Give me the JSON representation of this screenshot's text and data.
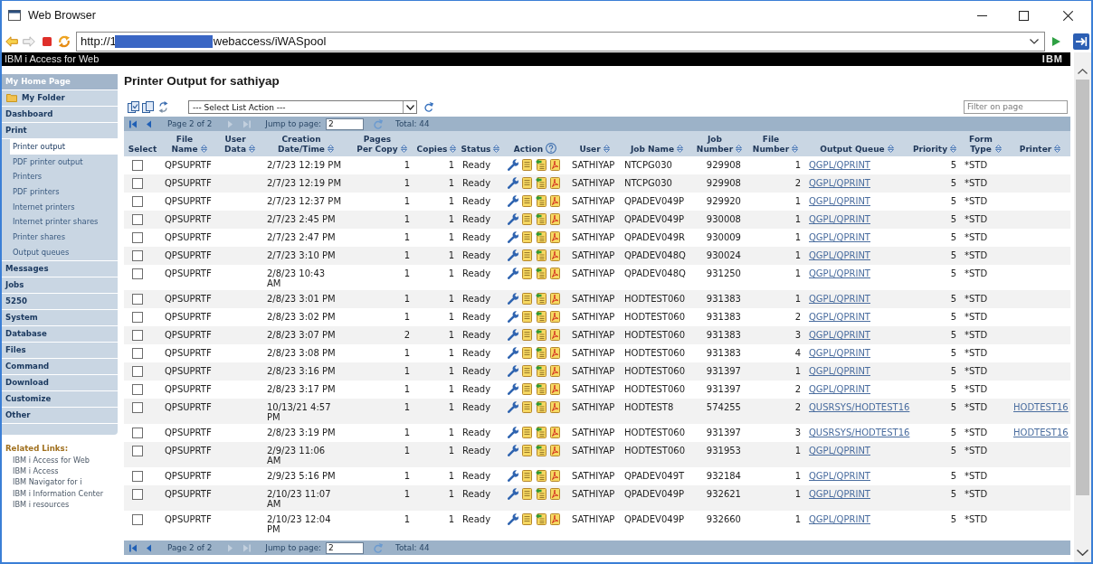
{
  "window": {
    "title": "Web Browser"
  },
  "address_bar": {
    "url_start": "http://1",
    "redacted": true,
    "url_end": "webaccess/iWASpool"
  },
  "banner": {
    "product": "IBM i Access for Web",
    "logo": "IBM"
  },
  "sidebar": {
    "items": [
      {
        "label": "My Home Page",
        "kind": "home",
        "selected": false
      },
      {
        "label": "My Folder",
        "kind": "folder",
        "selected": false
      },
      {
        "label": "Dashboard",
        "kind": "category",
        "selected": false
      },
      {
        "label": "Print",
        "kind": "category",
        "selected": false,
        "children": [
          {
            "label": "Printer output",
            "selected": true
          },
          {
            "label": "PDF printer output",
            "selected": false
          },
          {
            "label": "Printers",
            "selected": false
          },
          {
            "label": "PDF printers",
            "selected": false
          },
          {
            "label": "Internet printers",
            "selected": false
          },
          {
            "label": "Internet printer shares",
            "selected": false
          },
          {
            "label": "Printer shares",
            "selected": false
          },
          {
            "label": "Output queues",
            "selected": false
          }
        ]
      },
      {
        "label": "Messages",
        "kind": "category",
        "selected": false
      },
      {
        "label": "Jobs",
        "kind": "category",
        "selected": false
      },
      {
        "label": "5250",
        "kind": "category",
        "selected": false
      },
      {
        "label": "System",
        "kind": "category",
        "selected": false
      },
      {
        "label": "Database",
        "kind": "category",
        "selected": false
      },
      {
        "label": "Files",
        "kind": "category",
        "selected": false
      },
      {
        "label": "Command",
        "kind": "category",
        "selected": false
      },
      {
        "label": "Download",
        "kind": "category",
        "selected": false
      },
      {
        "label": "Customize",
        "kind": "category",
        "selected": false
      },
      {
        "label": "Other",
        "kind": "category",
        "selected": false
      }
    ]
  },
  "related_links": {
    "heading": "Related Links:",
    "links": [
      "IBM i Access for Web",
      "IBM i Access",
      "IBM Navigator for i",
      "IBM i Information Center",
      "IBM i resources"
    ]
  },
  "page": {
    "title": "Printer Output for sathiyap"
  },
  "toolbar": {
    "list_action": "--- Select List Action ---",
    "filter_placeholder": "Filter on page"
  },
  "pagers": [
    {
      "first_disabled": false,
      "previous_disabled": false,
      "page_label": "Page 2 of 2",
      "next_disabled": true,
      "last_disabled": true,
      "jump_label": "Jump to page:",
      "jump_value": "2",
      "total": "Total: 44"
    },
    {
      "first_disabled": false,
      "previous_disabled": false,
      "page_label": "Page 2 of 2",
      "next_disabled": true,
      "last_disabled": true,
      "jump_label": "Jump to page:",
      "jump_value": "2",
      "total": "Total: 44"
    }
  ],
  "table": {
    "columns": [
      {
        "label": "Select",
        "kind": "plain"
      },
      {
        "label": "File\nName",
        "kind": "sortable"
      },
      {
        "label": "User\nData",
        "kind": "sortable"
      },
      {
        "label": "Creation\nDate/Time",
        "kind": "sortable"
      },
      {
        "label": "Pages\nPer Copy",
        "kind": "sortable"
      },
      {
        "label": "Copies",
        "kind": "sortable"
      },
      {
        "label": "Status",
        "kind": "sortable"
      },
      {
        "label": "Action",
        "kind": "help"
      },
      {
        "label": "User",
        "kind": "sortable"
      },
      {
        "label": "Job Name",
        "kind": "sortable"
      },
      {
        "label": "Job\nNumber",
        "kind": "sortable"
      },
      {
        "label": "File\nNumber",
        "kind": "sortable"
      },
      {
        "label": "Output Queue",
        "kind": "sortable"
      },
      {
        "label": "Priority",
        "kind": "sortable"
      },
      {
        "label": "Form\nType",
        "kind": "sortable"
      },
      {
        "label": "Printer",
        "kind": "sortable"
      }
    ],
    "rows": [
      {
        "checked": false,
        "file_name": "QPSUPRTF",
        "created": "2/7/23 12:19 PM",
        "pages_per_copy": "1",
        "copies": "1",
        "status": "Ready",
        "user": "SATHIYAP",
        "job_name": "NTCPG030",
        "job_number": "929908",
        "file_number": "1",
        "output_queue": "QGPL/QPRINT",
        "priority": "5",
        "form_type": "*STD"
      },
      {
        "checked": false,
        "file_name": "QPSUPRTF",
        "created": "2/7/23 12:19 PM",
        "pages_per_copy": "1",
        "copies": "1",
        "status": "Ready",
        "user": "SATHIYAP",
        "job_name": "NTCPG030",
        "job_number": "929908",
        "file_number": "2",
        "output_queue": "QGPL/QPRINT",
        "priority": "5",
        "form_type": "*STD"
      },
      {
        "checked": false,
        "file_name": "QPSUPRTF",
        "created": "2/7/23 12:37 PM",
        "pages_per_copy": "1",
        "copies": "1",
        "status": "Ready",
        "user": "SATHIYAP",
        "job_name": "QPADEV049P",
        "job_number": "929920",
        "file_number": "1",
        "output_queue": "QGPL/QPRINT",
        "priority": "5",
        "form_type": "*STD"
      },
      {
        "checked": false,
        "file_name": "QPSUPRTF",
        "created": "2/7/23 2:45 PM",
        "pages_per_copy": "1",
        "copies": "1",
        "status": "Ready",
        "user": "SATHIYAP",
        "job_name": "QPADEV049P",
        "job_number": "930008",
        "file_number": "1",
        "output_queue": "QGPL/QPRINT",
        "priority": "5",
        "form_type": "*STD"
      },
      {
        "checked": false,
        "file_name": "QPSUPRTF",
        "created": "2/7/23 2:47 PM",
        "pages_per_copy": "1",
        "copies": "1",
        "status": "Ready",
        "user": "SATHIYAP",
        "job_name": "QPADEV049R",
        "job_number": "930009",
        "file_number": "1",
        "output_queue": "QGPL/QPRINT",
        "priority": "5",
        "form_type": "*STD"
      },
      {
        "checked": false,
        "file_name": "QPSUPRTF",
        "created": "2/7/23 3:10 PM",
        "pages_per_copy": "1",
        "copies": "1",
        "status": "Ready",
        "user": "SATHIYAP",
        "job_name": "QPADEV048Q",
        "job_number": "930024",
        "file_number": "1",
        "output_queue": "QGPL/QPRINT",
        "priority": "5",
        "form_type": "*STD"
      },
      {
        "checked": false,
        "file_name": "QPSUPRTF",
        "created": "2/8/23 10:43\nAM",
        "pages_per_copy": "1",
        "copies": "1",
        "status": "Ready",
        "user": "SATHIYAP",
        "job_name": "QPADEV048Q",
        "job_number": "931250",
        "file_number": "1",
        "output_queue": "QGPL/QPRINT",
        "priority": "5",
        "form_type": "*STD"
      },
      {
        "checked": false,
        "file_name": "QPSUPRTF",
        "created": "2/8/23 3:01 PM",
        "pages_per_copy": "1",
        "copies": "1",
        "status": "Ready",
        "user": "SATHIYAP",
        "job_name": "HODTEST060",
        "job_number": "931383",
        "file_number": "1",
        "output_queue": "QGPL/QPRINT",
        "priority": "5",
        "form_type": "*STD"
      },
      {
        "checked": false,
        "file_name": "QPSUPRTF",
        "created": "2/8/23 3:02 PM",
        "pages_per_copy": "1",
        "copies": "1",
        "status": "Ready",
        "user": "SATHIYAP",
        "job_name": "HODTEST060",
        "job_number": "931383",
        "file_number": "2",
        "output_queue": "QGPL/QPRINT",
        "priority": "5",
        "form_type": "*STD"
      },
      {
        "checked": false,
        "file_name": "QPSUPRTF",
        "created": "2/8/23 3:07 PM",
        "pages_per_copy": "2",
        "copies": "1",
        "status": "Ready",
        "user": "SATHIYAP",
        "job_name": "HODTEST060",
        "job_number": "931383",
        "file_number": "3",
        "output_queue": "QGPL/QPRINT",
        "priority": "5",
        "form_type": "*STD"
      },
      {
        "checked": false,
        "file_name": "QPSUPRTF",
        "created": "2/8/23 3:08 PM",
        "pages_per_copy": "1",
        "copies": "1",
        "status": "Ready",
        "user": "SATHIYAP",
        "job_name": "HODTEST060",
        "job_number": "931383",
        "file_number": "4",
        "output_queue": "QGPL/QPRINT",
        "priority": "5",
        "form_type": "*STD"
      },
      {
        "checked": false,
        "file_name": "QPSUPRTF",
        "created": "2/8/23 3:16 PM",
        "pages_per_copy": "1",
        "copies": "1",
        "status": "Ready",
        "user": "SATHIYAP",
        "job_name": "HODTEST060",
        "job_number": "931397",
        "file_number": "1",
        "output_queue": "QGPL/QPRINT",
        "priority": "5",
        "form_type": "*STD"
      },
      {
        "checked": false,
        "file_name": "QPSUPRTF",
        "created": "2/8/23 3:17 PM",
        "pages_per_copy": "1",
        "copies": "1",
        "status": "Ready",
        "user": "SATHIYAP",
        "job_name": "HODTEST060",
        "job_number": "931397",
        "file_number": "2",
        "output_queue": "QGPL/QPRINT",
        "priority": "5",
        "form_type": "*STD"
      },
      {
        "checked": false,
        "file_name": "QPSUPRTF",
        "created": "10/13/21 4:57\nPM",
        "pages_per_copy": "1",
        "copies": "1",
        "status": "Ready",
        "user": "SATHIYAP",
        "job_name": "HODTEST8",
        "job_number": "574255",
        "file_number": "2",
        "output_queue": "QUSRSYS/HODTEST16",
        "priority": "5",
        "form_type": "*STD",
        "printer": "HODTEST16"
      },
      {
        "checked": false,
        "file_name": "QPSUPRTF",
        "created": "2/8/23 3:19 PM",
        "pages_per_copy": "1",
        "copies": "1",
        "status": "Ready",
        "user": "SATHIYAP",
        "job_name": "HODTEST060",
        "job_number": "931397",
        "file_number": "3",
        "output_queue": "QUSRSYS/HODTEST16",
        "priority": "5",
        "form_type": "*STD",
        "printer": "HODTEST16"
      },
      {
        "checked": false,
        "file_name": "QPSUPRTF",
        "created": "2/9/23 11:06\nAM",
        "pages_per_copy": "1",
        "copies": "1",
        "status": "Ready",
        "user": "SATHIYAP",
        "job_name": "HODTEST060",
        "job_number": "931953",
        "file_number": "1",
        "output_queue": "QGPL/QPRINT",
        "priority": "5",
        "form_type": "*STD"
      },
      {
        "checked": false,
        "file_name": "QPSUPRTF",
        "created": "2/9/23 5:16 PM",
        "pages_per_copy": "1",
        "copies": "1",
        "status": "Ready",
        "user": "SATHIYAP",
        "job_name": "QPADEV049T",
        "job_number": "932184",
        "file_number": "1",
        "output_queue": "QGPL/QPRINT",
        "priority": "5",
        "form_type": "*STD"
      },
      {
        "checked": false,
        "file_name": "QPSUPRTF",
        "created": "2/10/23 11:07\nAM",
        "pages_per_copy": "1",
        "copies": "1",
        "status": "Ready",
        "user": "SATHIYAP",
        "job_name": "QPADEV049P",
        "job_number": "932621",
        "file_number": "1",
        "output_queue": "QGPL/QPRINT",
        "priority": "5",
        "form_type": "*STD"
      },
      {
        "checked": false,
        "file_name": "QPSUPRTF",
        "created": "2/10/23 12:04\nPM",
        "pages_per_copy": "1",
        "copies": "1",
        "status": "Ready",
        "user": "SATHIYAP",
        "job_name": "QPADEV049P",
        "job_number": "932660",
        "file_number": "1",
        "output_queue": "QGPL/QPRINT",
        "priority": "5",
        "form_type": "*STD"
      }
    ]
  }
}
